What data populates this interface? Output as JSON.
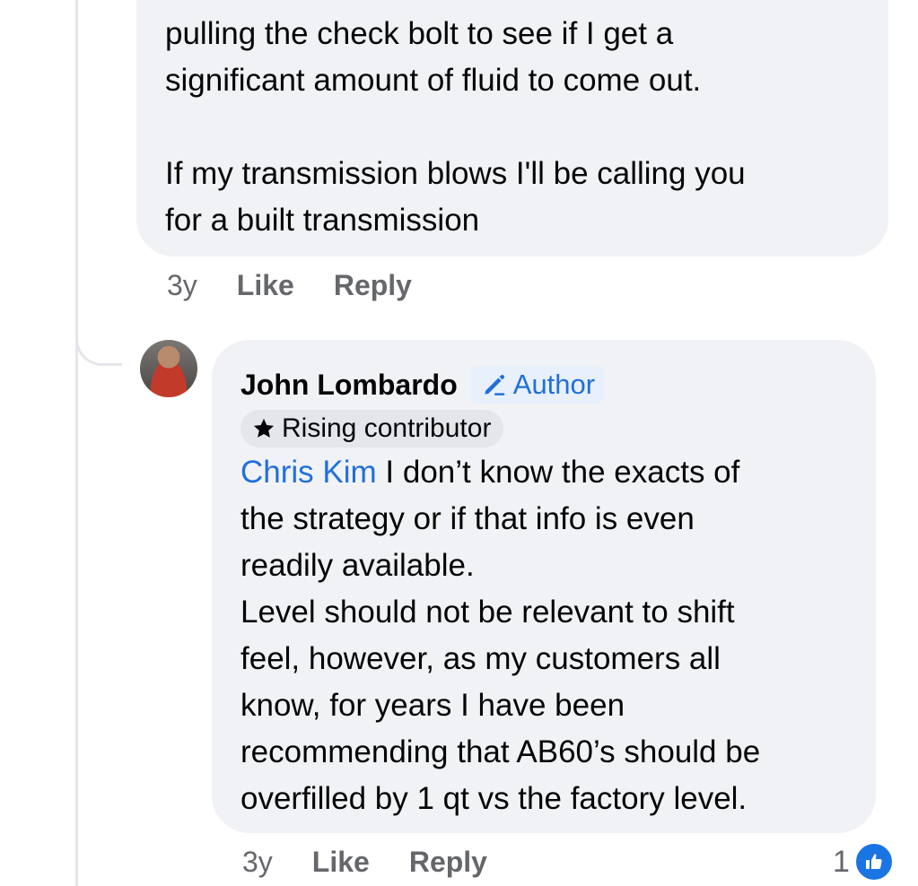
{
  "parent_comment": {
    "text": "pulling the check bolt to see if I get a\nsignificant amount of fluid to come out.\n\nIf my transmission blows I'll be calling you\nfor a built transmission",
    "time": "3y",
    "like_label": "Like",
    "reply_label": "Reply"
  },
  "reply_comment": {
    "author": "John Lombardo",
    "author_badge": "Author",
    "author_badge_icon": "pencil-icon",
    "contributor_badge": "Rising contributor",
    "contributor_badge_icon": "star-icon",
    "mention": "Chris Kim",
    "text": " I don’t know the exacts of\nthe strategy or if that info is even\nreadily available.\nLevel should not be relevant to shift\nfeel, however, as my customers all\nknow, for years I have been\nrecommending that AB60’s should be\noverfilled by 1 qt vs the factory level.",
    "time": "3y",
    "like_label": "Like",
    "reply_label": "Reply",
    "reaction_count": "1",
    "reaction_icon": "thumbs-up-icon"
  },
  "colors": {
    "bubble_bg": "#f0f2f5",
    "meta_text": "#65676b",
    "link_blue": "#216fdb",
    "like_blue": "#1b74e4"
  }
}
